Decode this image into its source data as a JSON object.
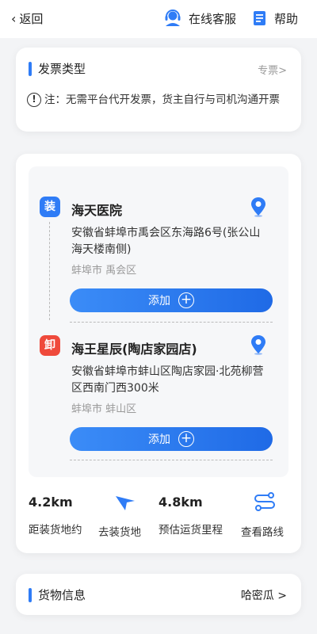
{
  "header": {
    "back_label": "返回",
    "service_label": "在线客服",
    "help_label": "帮助"
  },
  "invoice": {
    "title": "发票类型",
    "type_value": "专票>",
    "note": "注：无需平台代开发票，货主自行与司机沟通开票"
  },
  "load": {
    "badge": "装",
    "name": "海天医院",
    "address": "安徽省蚌埠市禹会区东海路6号(张公山海天楼南侧)",
    "city": "蚌埠市 禹会区",
    "add_label": "添加"
  },
  "unload": {
    "badge": "卸",
    "name": "海王星辰(陶店家园店)",
    "address": "安徽省蚌埠市蚌山区陶店家园·北苑柳营区西南门西300米",
    "city": "蚌埠市 蚌山区",
    "add_label": "添加"
  },
  "stats": {
    "distance_value": "4.2km",
    "distance_label": "距装货地约",
    "navigate_label": "去装货地",
    "mileage_value": "4.8km",
    "mileage_label": "预估运货里程",
    "route_label": "查看路线"
  },
  "goods": {
    "title": "货物信息",
    "value": "哈密瓜 >"
  },
  "colors": {
    "accent": "#2f7cf6",
    "unload_badge": "#ef4a3c"
  },
  "icons": {
    "back": "chevron-left-icon",
    "service": "headset-icon",
    "help": "help-document-icon",
    "pin": "location-pin-icon",
    "navigate": "navigation-arrow-icon",
    "route": "route-icon"
  }
}
